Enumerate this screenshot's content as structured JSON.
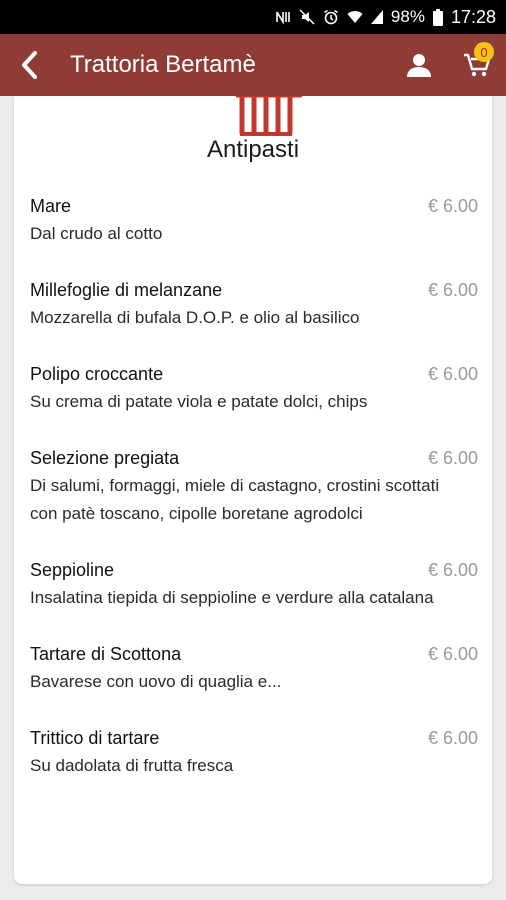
{
  "status_bar": {
    "battery": "98%",
    "time": "17:28",
    "icons": [
      "nfc-icon",
      "mute-icon",
      "alarm-icon",
      "wifi-icon",
      "signal-icon",
      "battery-icon"
    ]
  },
  "app_bar": {
    "title": "Trattoria Bertamè",
    "cart_count": "0",
    "background_color": "#8f3b36",
    "badge_color": "#f3c313"
  },
  "category": {
    "title": "Antipasti",
    "logo_color": "#c0392b"
  },
  "menu_items": [
    {
      "name": "Mare",
      "price": "€ 6.00",
      "description": "Dal crudo al cotto"
    },
    {
      "name": "Millefoglie di melanzane",
      "price": "€ 6.00",
      "description": "Mozzarella di bufala D.O.P. e olio al basilico"
    },
    {
      "name": "Polipo croccante",
      "price": "€ 6.00",
      "description": "Su crema di patate viola e patate dolci, chips"
    },
    {
      "name": "Selezione pregiata",
      "price": "€ 6.00",
      "description": "Di salumi, formaggi, miele di castagno, crostini scottati con patè toscano, cipolle boretane agrodolci"
    },
    {
      "name": "Seppioline",
      "price": "€ 6.00",
      "description": "Insalatina tiepida di seppioline e verdure alla catalana"
    },
    {
      "name": "Tartare di Scottona",
      "price": "€ 6.00",
      "description": "Bavarese con uovo di quaglia e..."
    },
    {
      "name": "Trittico di tartare",
      "price": "€ 6.00",
      "description": "Su dadolata di frutta fresca"
    }
  ]
}
